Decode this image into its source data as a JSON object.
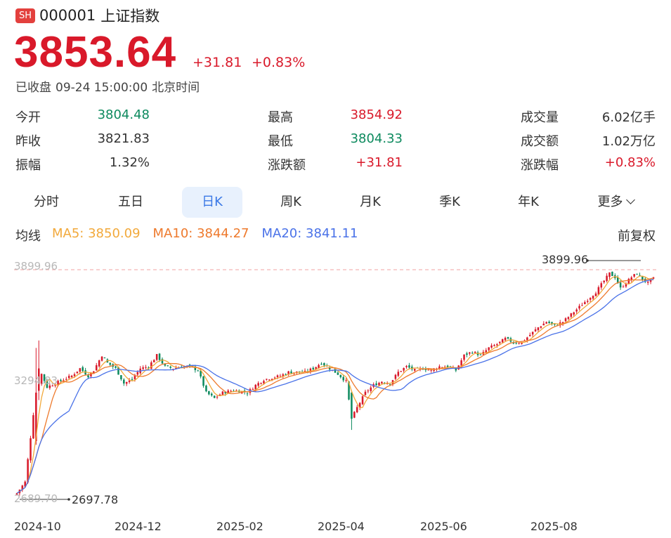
{
  "header": {
    "badge": "SH",
    "code": "000001",
    "name": "上证指数"
  },
  "quote": {
    "price": "3853.64",
    "change": "+31.81",
    "change_pct": "+0.83%",
    "status": "已收盘",
    "datetime": "09-24 15:00:00",
    "timezone": "北京时间"
  },
  "stats": [
    {
      "label": "今开",
      "value": "3804.48",
      "tone": "down"
    },
    {
      "label": "昨收",
      "value": "3821.83",
      "tone": "flat"
    },
    {
      "label": "振幅",
      "value": "1.32%",
      "tone": "flat"
    },
    {
      "label": "最高",
      "value": "3854.92",
      "tone": "up"
    },
    {
      "label": "最低",
      "value": "3804.33",
      "tone": "down"
    },
    {
      "label": "涨跌额",
      "value": "+31.81",
      "tone": "up"
    },
    {
      "label": "成交量",
      "value": "6.02亿手",
      "tone": "flat"
    },
    {
      "label": "成交额",
      "value": "1.02万亿",
      "tone": "flat"
    },
    {
      "label": "涨跌幅",
      "value": "+0.83%",
      "tone": "up"
    }
  ],
  "tabs": [
    {
      "label": "分时",
      "active": false
    },
    {
      "label": "五日",
      "active": false
    },
    {
      "label": "日K",
      "active": true
    },
    {
      "label": "周K",
      "active": false
    },
    {
      "label": "月K",
      "active": false
    },
    {
      "label": "季K",
      "active": false
    },
    {
      "label": "年K",
      "active": false
    },
    {
      "label": "更多",
      "active": false
    }
  ],
  "ma_legend": {
    "label": "均线",
    "items": [
      {
        "text": "MA5: 3850.09",
        "color": "#f2a93b"
      },
      {
        "text": "MA10: 3844.27",
        "color": "#ee7a2d"
      },
      {
        "text": "MA20: 3841.11",
        "color": "#4a72e8"
      }
    ]
  },
  "adjust_label": "前复权",
  "colors": {
    "up": "#d9192a",
    "down": "#0d8a5e",
    "accent": "#3a78e6"
  },
  "chart_data": {
    "type": "candlestick",
    "y_axis_labels": [
      "3899.96",
      "3294.83",
      "2689.70"
    ],
    "max_label": "3899.96",
    "min_label": "2697.78",
    "x_labels": [
      "2024-10",
      "2024-12",
      "2025-02",
      "2025-04",
      "2025-06",
      "2025-08"
    ],
    "ylim": [
      2689.7,
      3899.96
    ],
    "ma_series": [
      "MA5",
      "MA10",
      "MA20"
    ],
    "close_trend": [
      [
        0,
        2700
      ],
      [
        3,
        2760
      ],
      [
        5,
        3000
      ],
      [
        7,
        3250
      ],
      [
        9,
        3340
      ],
      [
        11,
        3270
      ],
      [
        14,
        3290
      ],
      [
        17,
        3310
      ],
      [
        20,
        3330
      ],
      [
        23,
        3370
      ],
      [
        26,
        3330
      ],
      [
        28,
        3360
      ],
      [
        31,
        3440
      ],
      [
        33,
        3400
      ],
      [
        36,
        3370
      ],
      [
        39,
        3290
      ],
      [
        42,
        3310
      ],
      [
        45,
        3370
      ],
      [
        48,
        3380
      ],
      [
        51,
        3440
      ],
      [
        54,
        3380
      ],
      [
        57,
        3370
      ],
      [
        60,
        3380
      ],
      [
        63,
        3380
      ],
      [
        66,
        3360
      ],
      [
        69,
        3240
      ],
      [
        72,
        3210
      ],
      [
        75,
        3240
      ],
      [
        78,
        3250
      ],
      [
        81,
        3250
      ],
      [
        84,
        3240
      ],
      [
        87,
        3280
      ],
      [
        90,
        3310
      ],
      [
        93,
        3320
      ],
      [
        96,
        3330
      ],
      [
        99,
        3350
      ],
      [
        102,
        3350
      ],
      [
        105,
        3350
      ],
      [
        108,
        3370
      ],
      [
        111,
        3400
      ],
      [
        114,
        3370
      ],
      [
        117,
        3340
      ],
      [
        120,
        3300
      ],
      [
        122,
        3100
      ],
      [
        124,
        3160
      ],
      [
        127,
        3240
      ],
      [
        130,
        3280
      ],
      [
        133,
        3300
      ],
      [
        136,
        3290
      ],
      [
        139,
        3350
      ],
      [
        142,
        3380
      ],
      [
        145,
        3360
      ],
      [
        148,
        3370
      ],
      [
        151,
        3360
      ],
      [
        154,
        3380
      ],
      [
        157,
        3380
      ],
      [
        160,
        3360
      ],
      [
        163,
        3440
      ],
      [
        166,
        3460
      ],
      [
        169,
        3440
      ],
      [
        172,
        3480
      ],
      [
        175,
        3500
      ],
      [
        178,
        3530
      ],
      [
        181,
        3510
      ],
      [
        184,
        3510
      ],
      [
        187,
        3550
      ],
      [
        190,
        3590
      ],
      [
        193,
        3620
      ],
      [
        196,
        3600
      ],
      [
        199,
        3620
      ],
      [
        202,
        3660
      ],
      [
        205,
        3700
      ],
      [
        208,
        3740
      ],
      [
        211,
        3780
      ],
      [
        214,
        3840
      ],
      [
        216,
        3880
      ],
      [
        218,
        3860
      ],
      [
        220,
        3800
      ],
      [
        222,
        3830
      ],
      [
        224,
        3860
      ],
      [
        226,
        3880
      ],
      [
        228,
        3850
      ],
      [
        230,
        3828
      ],
      [
        232,
        3853
      ]
    ]
  }
}
